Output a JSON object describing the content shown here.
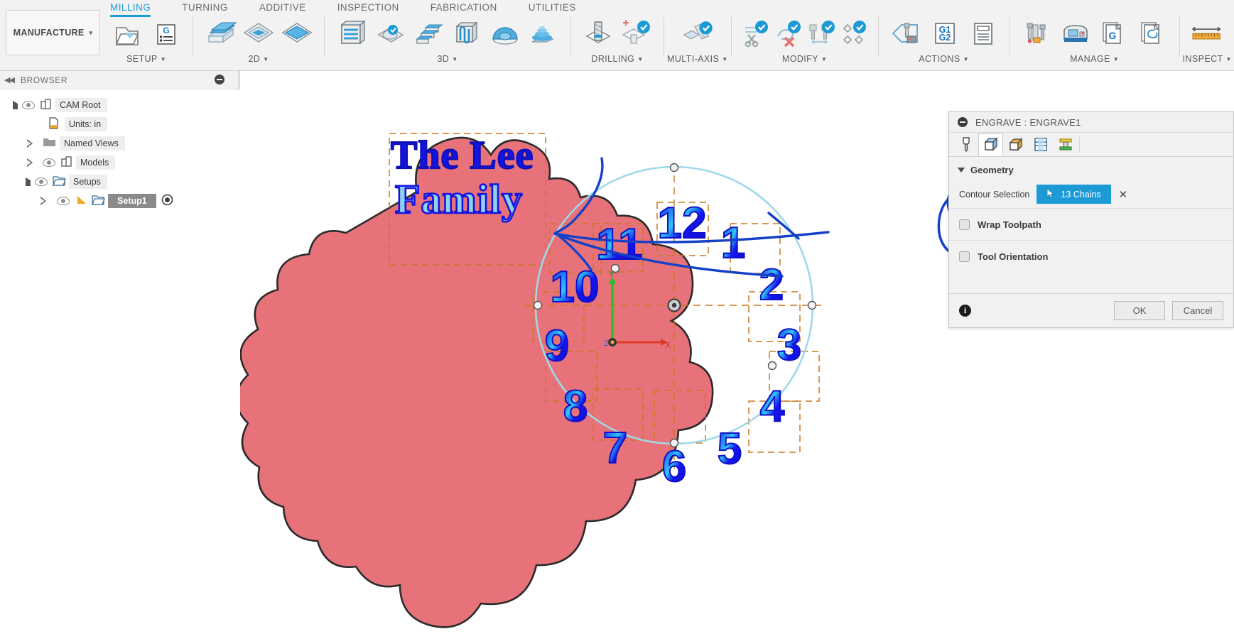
{
  "app": {
    "workspace_label": "MANUFACTURE",
    "workspace_caret": "▾"
  },
  "ribbon": {
    "tabs": [
      {
        "label": "MILLING",
        "active": true
      },
      {
        "label": "TURNING",
        "active": false
      },
      {
        "label": "ADDITIVE",
        "active": false
      },
      {
        "label": "INSPECTION",
        "active": false
      },
      {
        "label": "FABRICATION",
        "active": false
      },
      {
        "label": "UTILITIES",
        "active": false
      }
    ],
    "panels": [
      {
        "label": "SETUP",
        "has_caret": true,
        "icons": [
          "setup-folder-icon",
          "g-code-list-icon"
        ]
      },
      {
        "label": "2D",
        "has_caret": true,
        "icons": [
          "face-2d-icon",
          "adaptive-2d-icon",
          "pocket-2d-icon"
        ]
      },
      {
        "label": "3D",
        "has_caret": true,
        "icons": [
          "adaptive-clearing-icon",
          "pocket-clearing-icon",
          "horizontal-icon",
          "parallel-icon",
          "scallop-icon",
          "spiral-icon"
        ]
      },
      {
        "label": "DRILLING",
        "has_caret": true,
        "icons": [
          "drill-icon",
          "drill-new-icon"
        ]
      },
      {
        "label": "MULTI-AXIS",
        "has_caret": true,
        "icons": [
          "multi-axis-icon"
        ]
      },
      {
        "label": "MODIFY",
        "has_caret": true,
        "icons": [
          "trim-icon",
          "delete-toolpath-icon",
          "tool-change-icon",
          "transform-icon"
        ]
      },
      {
        "label": "ACTIONS",
        "has_caret": true,
        "icons": [
          "simulate-icon",
          "g1-g2-post-icon",
          "setup-sheet-icon"
        ]
      },
      {
        "label": "MANAGE",
        "has_caret": true,
        "icons": [
          "tool-library-icon",
          "machine-library-icon",
          "post-library-icon",
          "template-library-icon"
        ]
      },
      {
        "label": "INSPECT",
        "has_caret": true,
        "icons": [
          "measure-icon"
        ]
      }
    ]
  },
  "browser": {
    "title": "BROWSER",
    "collapse_icon": "collapse-left-icon",
    "tree": [
      {
        "label": "CAM Root",
        "depth": 0,
        "toggle": "expanded",
        "eye": true,
        "icon": "body-icon",
        "selected": false,
        "extra": null
      },
      {
        "label": "Units: in",
        "depth": 1,
        "toggle": "none",
        "eye": false,
        "icon": "units-icon",
        "selected": false,
        "extra": null
      },
      {
        "label": "Named Views",
        "depth": 1,
        "toggle": "collapsed",
        "eye": false,
        "icon": "folder-icon",
        "selected": false,
        "extra": null
      },
      {
        "label": "Models",
        "depth": 1,
        "toggle": "collapsed",
        "eye": true,
        "icon": "body-icon",
        "selected": false,
        "extra": null
      },
      {
        "label": "Setups",
        "depth": 1,
        "toggle": "expanded",
        "eye": true,
        "icon": "setup-folder-icon",
        "selected": false,
        "extra": null
      },
      {
        "label": "Setup1",
        "depth": 2,
        "toggle": "collapsed",
        "eye": true,
        "icon": "setup-folder-icon",
        "selected": true,
        "extra": "active-setup-radio"
      }
    ]
  },
  "dialog": {
    "title": "ENGRAVE : ENGRAVE1",
    "minimize_icon": "minimize-icon",
    "tabs": [
      {
        "name": "tool-tab",
        "icon": "end-mill-icon",
        "selected": false
      },
      {
        "name": "geometry-tab",
        "icon": "geometry-icon",
        "selected": true
      },
      {
        "name": "heights-tab",
        "icon": "heights-icon",
        "selected": false
      },
      {
        "name": "passes-tab",
        "icon": "passes-icon",
        "selected": false
      },
      {
        "name": "linking-tab",
        "icon": "linking-icon",
        "selected": false
      }
    ],
    "section": {
      "label": "Geometry",
      "expanded": true
    },
    "contour_selection": {
      "label": "Contour Selection",
      "chip_value": "13 Chains",
      "chip_color": "#1c9ad6",
      "chip_cursor_icon": "cursor-arrow-icon",
      "clear_icon": "clear-selection-x-icon"
    },
    "checkboxes": [
      {
        "label": "Wrap Toolpath",
        "checked": false
      },
      {
        "label": "Tool Orientation",
        "checked": false
      }
    ],
    "footer": {
      "info_icon": "info-icon",
      "ok_label": "OK",
      "cancel_label": "Cancel"
    }
  },
  "canvas": {
    "part_name": "clock-face-part",
    "part_fill": "#e8727a",
    "part_stroke": "#2b2b2b",
    "engrave_text": {
      "line1": "The Lee",
      "line2": "Family",
      "fill_line1": "#1414e0",
      "fill_line2": "#8fd2ee",
      "stroke": "#1414e0"
    },
    "clock_numerals": [
      "12",
      "1",
      "2",
      "3",
      "4",
      "5",
      "6",
      "7",
      "8",
      "9",
      "10",
      "11"
    ],
    "numeral_fill": "#1414f0",
    "numeral_highlight": "#2fc8f5",
    "sketch_color": "#c87820",
    "circle_color": "#9fd8ea",
    "axis": {
      "x_label": "X",
      "y_label": "Y",
      "z_label": "Z",
      "x_color": "#e03a2a",
      "y_color": "#22c022",
      "z_color": "#2a5fe0"
    },
    "annotation": {
      "name": "blue-ink-annotation",
      "color": "#1440c8",
      "description": "hand-drawn arrow from engraved text to the 13 Chains chip, with a circle around the chip"
    }
  }
}
